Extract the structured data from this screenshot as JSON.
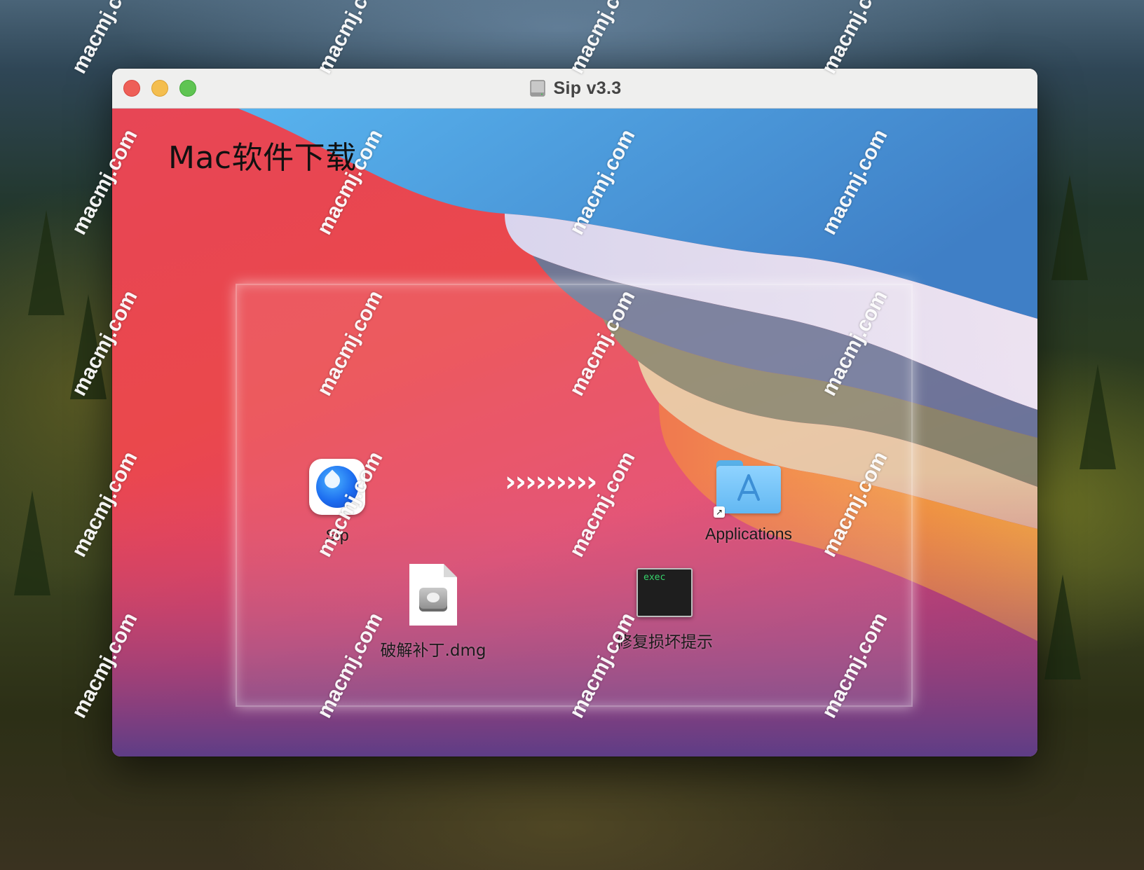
{
  "window": {
    "title": "Sip v3.3",
    "title_icon": "disk-image-icon"
  },
  "content": {
    "headline": "Mac软件下载",
    "install_arrows": "›››››››››",
    "items": {
      "app": {
        "label": "Sip",
        "icon": "sip-app-icon"
      },
      "applications": {
        "label": "Applications",
        "icon": "applications-folder-icon"
      },
      "patch": {
        "label": "破解补丁.dmg",
        "icon": "dmg-file-icon"
      },
      "repair": {
        "label": "修复损坏提示",
        "icon": "exec-script-icon",
        "icon_text": "exec"
      }
    }
  },
  "watermark": {
    "text": "macmj.com"
  },
  "colors": {
    "close": "#ee5f57",
    "minimize": "#f4be4f",
    "maximize": "#5fc452",
    "titlebar": "#efefee",
    "folder": "#63b8f2"
  }
}
